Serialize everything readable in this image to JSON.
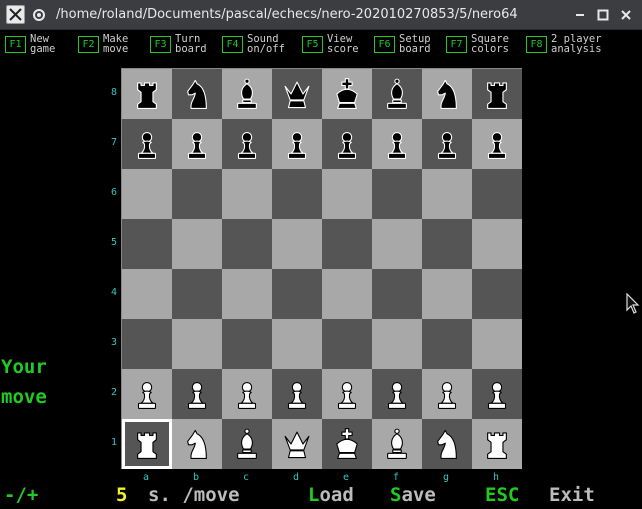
{
  "window": {
    "title": "/home/roland/Documents/pascal/echecs/nero-202010270853/5/nero64"
  },
  "function_keys": [
    {
      "key": "F1",
      "label": "New\ngame"
    },
    {
      "key": "F2",
      "label": "Make\nmove"
    },
    {
      "key": "F3",
      "label": "Turn\nboard"
    },
    {
      "key": "F4",
      "label": "Sound\non/off"
    },
    {
      "key": "F5",
      "label": "View\nscore"
    },
    {
      "key": "F6",
      "label": "Setup\nboard"
    },
    {
      "key": "F7",
      "label": "Square\ncolors"
    },
    {
      "key": "F8",
      "label": "2 player\nanalysis"
    }
  ],
  "board": {
    "ranks": [
      "8",
      "7",
      "6",
      "5",
      "4",
      "3",
      "2",
      "1"
    ],
    "files": [
      "a",
      "b",
      "c",
      "d",
      "e",
      "f",
      "g",
      "h"
    ],
    "cursor_square": "a1",
    "position": [
      [
        "r",
        "n",
        "b",
        "q",
        "k",
        "b",
        "n",
        "r"
      ],
      [
        "p",
        "p",
        "p",
        "p",
        "p",
        "p",
        "p",
        "p"
      ],
      [
        "",
        "",
        "",
        "",
        "",
        "",
        "",
        ""
      ],
      [
        "",
        "",
        "",
        "",
        "",
        "",
        "",
        ""
      ],
      [
        "",
        "",
        "",
        "",
        "",
        "",
        "",
        ""
      ],
      [
        "",
        "",
        "",
        "",
        "",
        "",
        "",
        ""
      ],
      [
        "P",
        "P",
        "P",
        "P",
        "P",
        "P",
        "P",
        "P"
      ],
      [
        "R",
        "N",
        "B",
        "Q",
        "K",
        "B",
        "N",
        "R"
      ]
    ]
  },
  "message": {
    "line1": "Your",
    "line2": "move"
  },
  "status": {
    "minus_plus": "-/+",
    "seconds_value": "5",
    "seconds_label": "s. /move",
    "load_key": "L",
    "load_rest": "oad",
    "save_key": "S",
    "save_rest": "ave",
    "esc_key": "ESC",
    "exit_label": "Exit"
  },
  "colors": {
    "light_square": "#a8a8a8",
    "dark_square": "#555555",
    "accent_green": "#22c922",
    "label_cyan": "#34c4c4",
    "highlight_yellow": "#f2f22a"
  }
}
